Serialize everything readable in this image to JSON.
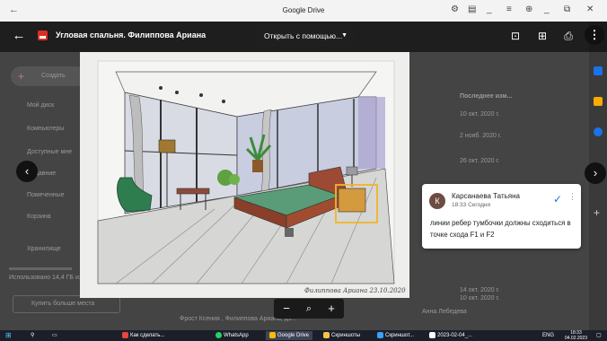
{
  "window": {
    "title": "Google Drive"
  },
  "drive_bg": {
    "create_label": "Создать",
    "sidebar_items": [
      "Мой диск",
      "Компьютеры",
      "Доступные мне",
      "Недавние",
      "Помеченные",
      "Корзина",
      "Хранилище"
    ],
    "storage_text": "Использовано 14,4 ГБ из 15 ГБ",
    "buy_storage_label": "Купить больше места",
    "col_header": "Последнее изм...",
    "modified_dates": [
      "10 окт. 2020 г.",
      "2 нояб. 2020 г.",
      "26 окт. 2020 г.",
      "14 окт. 2020 г.",
      "10 окт. 2020 г."
    ],
    "owner_text": "Анна Лебедева",
    "bottom_file_name": "Фрост Ксения , Филиппова Ариана, дз..."
  },
  "preview": {
    "file_title": "Угловая спальня. Филиппова Ариана",
    "open_with_label": "Открыть с помощью...",
    "signature": "Филиппова Ариана 23.10.2020"
  },
  "comment": {
    "avatar_letter": "К",
    "author": "Карсанаева Татьяна",
    "time": "18:33 Сегодня",
    "text": "линии ребер тумбочки должны сходиться в точке схода F1 и F2"
  },
  "zoom": {
    "minus": "−",
    "plus": "+"
  },
  "taskbar": {
    "items": [
      {
        "label": "Как сделать...",
        "color": "#e8453c"
      },
      {
        "label": "WhatsApp",
        "color": "#25d366"
      },
      {
        "label": "Google Drive",
        "color": "#fbbc04"
      },
      {
        "label": "Скриншоты",
        "color": "#f5c542"
      },
      {
        "label": "Скриншот...",
        "color": "#3aa0ff"
      },
      {
        "label": "2023-02-04_...",
        "color": "#ffffff"
      }
    ],
    "lang": "ENG",
    "time": "18:33",
    "date": "04.02.2023"
  },
  "colors": {
    "accent": "#1a73e8",
    "file_icon": "#d93025"
  }
}
